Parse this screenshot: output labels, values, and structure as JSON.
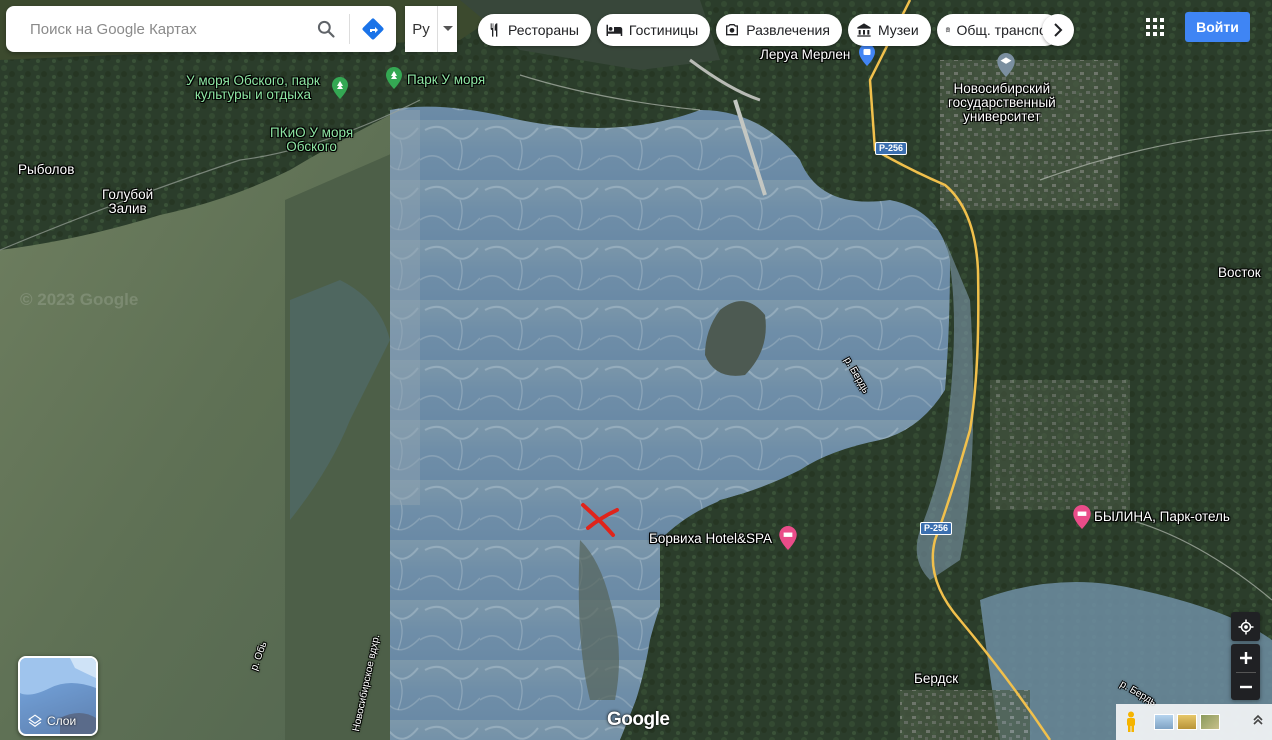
{
  "search": {
    "placeholder": "Поиск на Google Картах"
  },
  "input_tools": {
    "label": "Ру"
  },
  "chips": [
    {
      "label": "Рестораны",
      "icon": "restaurant-icon"
    },
    {
      "label": "Гостиницы",
      "icon": "hotel-icon"
    },
    {
      "label": "Развлечения",
      "icon": "camera-icon"
    },
    {
      "label": "Музеи",
      "icon": "museum-icon"
    },
    {
      "label": "Общ. транспорт",
      "icon": "transit-icon"
    }
  ],
  "signin_label": "Войти",
  "map_labels": {
    "park_obskoe": "У моря Обского, парк\nкультуры и отдыха",
    "park_u_morya": "Парк У моря",
    "pkio": "ПКиО У моря\nОбского",
    "leroy": "Леруа Мерлен",
    "nsu": "Новосибирский\nгосударственный\nуниверситет",
    "rybolov": "Рыболов",
    "goluboy_zaliv": "Голубой\nЗалив",
    "vostok": "Восток",
    "bylina": "БЫЛИНА, Парк-отель",
    "borvikha": "Борвиха Hotel&SPA",
    "berdsk": "Бердск",
    "river_berd_1": "р. Бердь",
    "river_berd_2": "р. Бердь",
    "river_ob": "р. Обь",
    "reservoir": "Новосибирское вдхр.",
    "copyright_ghost": "© 2023 Google"
  },
  "road_labels": [
    "Р-256",
    "Р-256"
  ],
  "layers_label": "Слои",
  "google_logo": "Google",
  "colors": {
    "signin": "#3f85f4",
    "green_poi": "#34a853",
    "pink_poi": "#ea4c89",
    "blue_poi": "#4285f4",
    "red_marker": "#e0241b",
    "road": "#f1c04c"
  }
}
